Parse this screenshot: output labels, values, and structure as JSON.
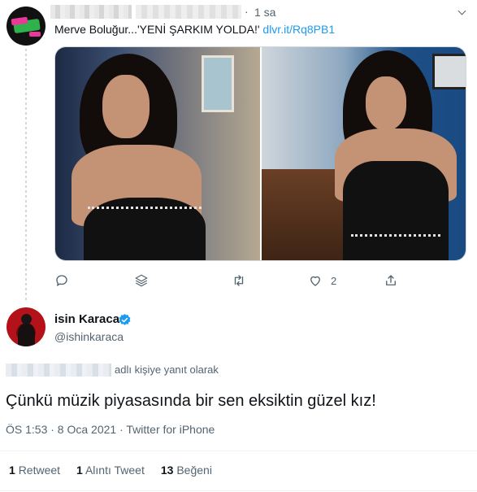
{
  "parent_tweet": {
    "time": "1 sa",
    "separator": "·",
    "text": "Merve Boluğur...'YENİ ŞARKIM YOLDA!'",
    "link": "dlvr.it/Rq8PB1",
    "actions": {
      "reply_icon": "reply-icon",
      "stack_icon": "stack-icon",
      "retweet_icon": "retweet-icon",
      "like_icon": "heart-icon",
      "like_count": "2",
      "share_icon": "share-icon"
    }
  },
  "main_tweet": {
    "name": "isin Karaca",
    "handle": "@ishinkaraca",
    "reply_to_suffix": "adlı kişiye yanıt olarak",
    "text": "Çünkü müzik piyasasında bir sen eksiktin güzel kız!",
    "meta": "ÖS 1:53 · 8 Oca 2021 · Twitter for iPhone",
    "stats": {
      "retweets_count": "1",
      "retweets_label": "Retweet",
      "quotes_count": "1",
      "quotes_label": "Alıntı Tweet",
      "likes_count": "13",
      "likes_label": "Beğeni"
    }
  },
  "colors": {
    "link": "#1d9bf0",
    "secondary_text": "#536471",
    "verified": "#1d9bf0"
  }
}
